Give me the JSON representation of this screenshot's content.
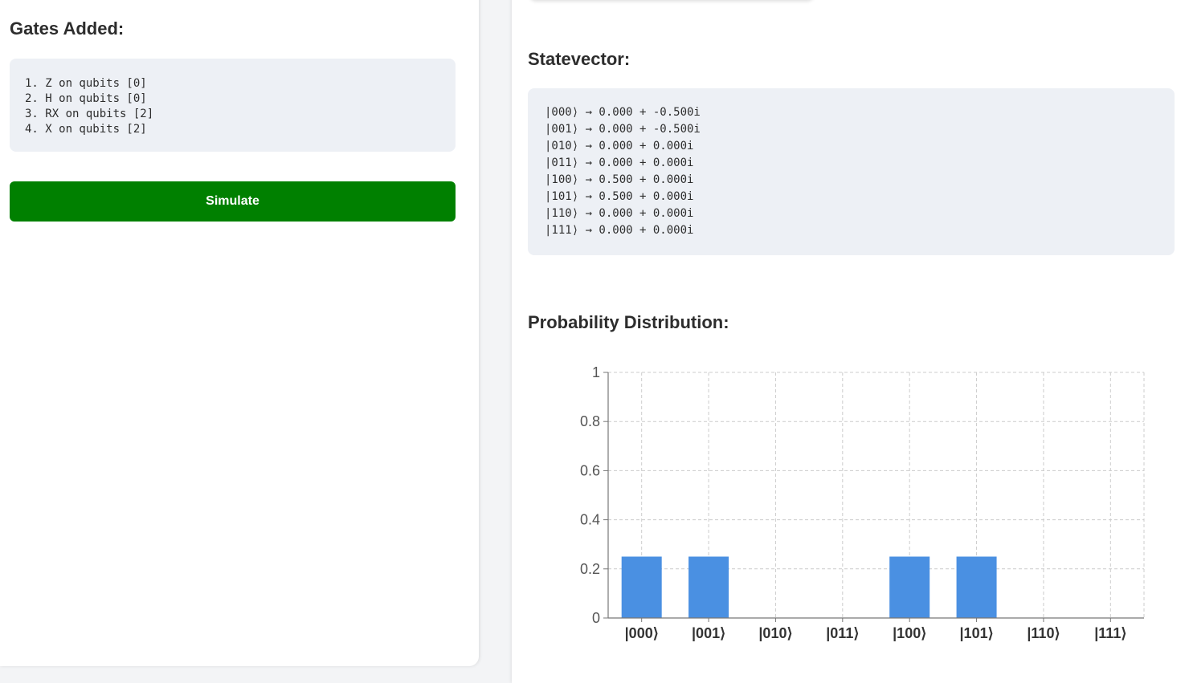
{
  "gates": {
    "title": "Gates Added:",
    "items": [
      "1. Z on qubits [0]",
      "2. H on qubits [0]",
      "3. RX on qubits [2]",
      "4. X on qubits [2]"
    ]
  },
  "simulate_label": "Simulate",
  "statevector": {
    "title": "Statevector:",
    "rows": [
      "|000⟩ → 0.000 + -0.500i",
      "|001⟩ → 0.000 + -0.500i",
      "|010⟩ → 0.000 + 0.000i",
      "|011⟩ → 0.000 + 0.000i",
      "|100⟩ → 0.500 + 0.000i",
      "|101⟩ → 0.500 + 0.000i",
      "|110⟩ → 0.000 + 0.000i",
      "|111⟩ → 0.000 + 0.000i"
    ]
  },
  "probability": {
    "title": "Probability Distribution:"
  },
  "colors": {
    "accent_green": "#008000",
    "bar_blue": "#4a90e2",
    "box_bg": "#edf0f5"
  },
  "chart_data": {
    "type": "bar",
    "categories": [
      "|000⟩",
      "|001⟩",
      "|010⟩",
      "|011⟩",
      "|100⟩",
      "|101⟩",
      "|110⟩",
      "|111⟩"
    ],
    "values": [
      0.25,
      0.25,
      0,
      0,
      0.25,
      0.25,
      0,
      0
    ],
    "yticks": [
      "0",
      "0.2",
      "0.4",
      "0.6",
      "0.8",
      "1"
    ],
    "ylim": [
      0,
      1
    ],
    "grid": true
  }
}
